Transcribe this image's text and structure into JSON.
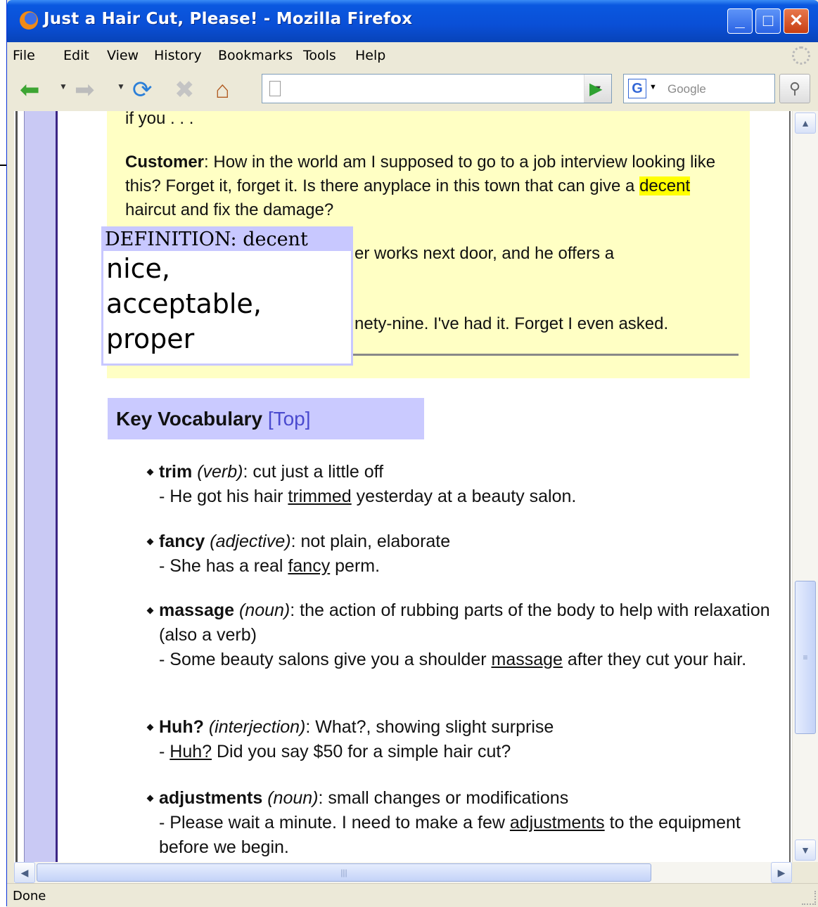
{
  "window": {
    "title": "Just a Hair Cut, Please! - Mozilla Firefox",
    "min": "_",
    "max": "□",
    "close": "✕"
  },
  "menu": [
    "File",
    "Edit",
    "View",
    "History",
    "Bookmarks",
    "Tools",
    "Help"
  ],
  "toolbar": {
    "url_value": "",
    "search_placeholder": "Google",
    "search_engine": "G"
  },
  "dialog": {
    "line0": "if you . . .",
    "customer_speaker": "Customer",
    "customer_text_a": ": How in the world am I supposed to go to a job interview looking like this? Forget it, forget it. Is there anyplace in this town that can give a ",
    "customer_highlight": "decent",
    "customer_text_b": " haircut and fix the damage?",
    "partial_line1": "er works next door, and he offers a",
    "partial_line2": "nety-nine. I've had it. Forget I even asked."
  },
  "popup": {
    "header": "DEFINITION: decent",
    "line1": "nice,",
    "line2": "acceptable,",
    "line3": "proper"
  },
  "vocab_section": {
    "title": "Key Vocabulary",
    "top_link": "[Top]"
  },
  "vocab": [
    {
      "word": "trim",
      "pos": "(verb)",
      "def": ": cut just a little off",
      "ex_pre": "- He got his hair ",
      "ex_u": "trimmed",
      "ex_post": " yesterday at a beauty salon."
    },
    {
      "word": "fancy",
      "pos": "(adjective)",
      "def": ": not plain, elaborate",
      "ex_pre": "- She has a real ",
      "ex_u": "fancy",
      "ex_post": " perm."
    },
    {
      "word": "massage",
      "pos": "(noun)",
      "def": ": the action of rubbing parts of the body to help with relaxation (also a verb)",
      "ex_pre": "- Some beauty salons give you a shoulder ",
      "ex_u": "massage",
      "ex_post": " after they cut your hair."
    },
    {
      "word": "Huh?",
      "pos": "(interjection)",
      "def": ": What?, showing slight surprise",
      "ex_pre": "- ",
      "ex_u": "Huh?",
      "ex_post": " Did you say $50 for a simple hair cut?"
    },
    {
      "word": "adjustments",
      "pos": "(noun)",
      "def": ": small changes or modifications",
      "ex_pre": "- Please wait a minute. I need to make a few ",
      "ex_u": "adjustments",
      "ex_post": " to the equipment before we begin."
    }
  ],
  "status": {
    "text": "Done"
  }
}
